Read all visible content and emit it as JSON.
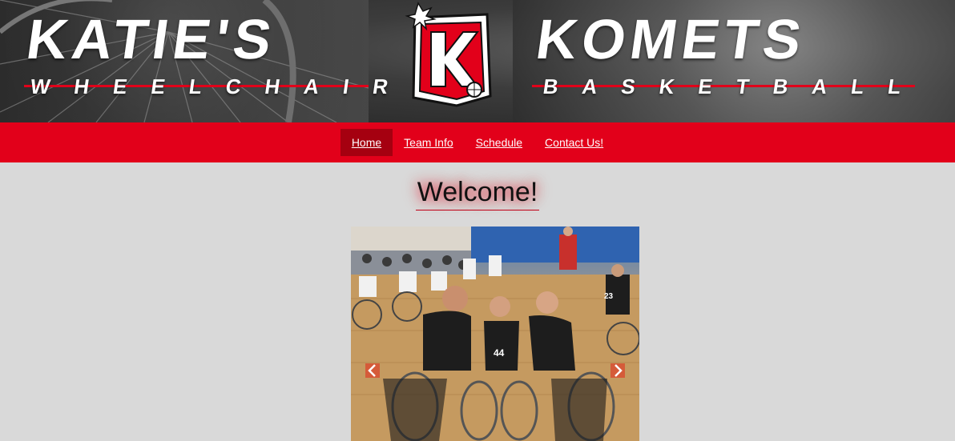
{
  "banner": {
    "title_left": "KATIE'S",
    "title_right": "KOMETS",
    "subtitle_left": "WHEELCHAIR",
    "subtitle_right": "BASKETBALL",
    "logo_letter": "K"
  },
  "nav": {
    "items": [
      {
        "label": "Home",
        "active": true
      },
      {
        "label": "Team Info",
        "active": false
      },
      {
        "label": "Schedule",
        "active": false
      },
      {
        "label": "Contact Us!",
        "active": false
      }
    ]
  },
  "main": {
    "heading": "Welcome!",
    "slideshow": {
      "prev_icon": "chevron-left-icon",
      "next_icon": "chevron-right-icon",
      "jersey_numbers": [
        "44",
        "23"
      ]
    }
  },
  "colors": {
    "accent_red": "#e2001a",
    "active_nav": "#a50010",
    "page_bg": "#d9d9d9"
  }
}
